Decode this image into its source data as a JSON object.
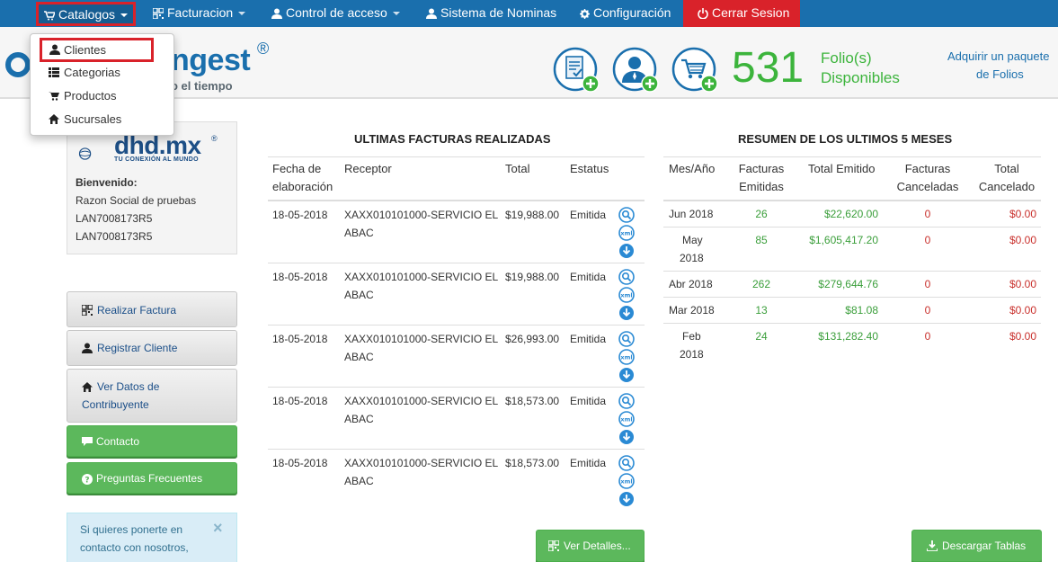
{
  "nav": {
    "catalogos": "Catalogos",
    "facturacion": "Facturacion",
    "control_acceso": "Control de acceso",
    "nominas": "Sistema de Nominas",
    "configuracion": "Configuración",
    "cerrar": "Cerrar Sesion"
  },
  "dropdown": {
    "items": [
      {
        "label": "Clientes",
        "icon": "user-icon"
      },
      {
        "label": "Categorias",
        "icon": "list-icon"
      },
      {
        "label": "Productos",
        "icon": "cart-icon"
      },
      {
        "label": "Sucursales",
        "icon": "home-icon"
      }
    ]
  },
  "header": {
    "brand_name": "ngest",
    "brand_reg": "®",
    "tagline": "o el tiempo",
    "folio_count": "531",
    "folio_label1": "Folio(s)",
    "folio_label2": "Disponibles",
    "buy_link1": "Adquirir un paquete",
    "buy_link2": "de Folios"
  },
  "profile": {
    "logo_text": "dhd.mx",
    "logo_reg": "®",
    "logo_tagline": "TU CONEXIÓN AL MUNDO",
    "welcome": "Bienvenido:",
    "razon": "Razon Social de pruebas",
    "rfc1": "LAN7008173R5",
    "rfc2": "LAN7008173R5"
  },
  "sidebar": {
    "factura": "Realizar Factura",
    "cliente": "Registrar Cliente",
    "datos1": "Ver Datos de",
    "datos2": "Contribuyente",
    "contacto": "Contacto",
    "preguntas": "Preguntas Frecuentes",
    "info_line1": "Si quieres ponerte en",
    "info_line2": "contacto con nosotros,",
    "info_close": "×"
  },
  "facturas": {
    "title": "ULTIMAS FACTURAS REALIZADAS",
    "headers": {
      "fecha1": "Fecha de",
      "fecha2": "elaboración",
      "receptor": "Receptor",
      "total": "Total",
      "estatus": "Estatus"
    },
    "rows": [
      {
        "fecha": "18-05-2018",
        "receptor1": "XAXX010101000-SERVICIO EL",
        "receptor2": "ABAC",
        "total": "$19,988.00",
        "estatus": "Emitida"
      },
      {
        "fecha": "18-05-2018",
        "receptor1": "XAXX010101000-SERVICIO EL",
        "receptor2": "ABAC",
        "total": "$19,988.00",
        "estatus": "Emitida"
      },
      {
        "fecha": "18-05-2018",
        "receptor1": "XAXX010101000-SERVICIO EL",
        "receptor2": "ABAC",
        "total": "$26,993.00",
        "estatus": "Emitida"
      },
      {
        "fecha": "18-05-2018",
        "receptor1": "XAXX010101000-SERVICIO EL",
        "receptor2": "ABAC",
        "total": "$18,573.00",
        "estatus": "Emitida"
      },
      {
        "fecha": "18-05-2018",
        "receptor1": "XAXX010101000-SERVICIO EL",
        "receptor2": "ABAC",
        "total": "$18,573.00",
        "estatus": "Emitida"
      }
    ],
    "xml_label": "xml",
    "details_button": "Ver Detalles..."
  },
  "resumen": {
    "title": "RESUMEN DE LOS ULTIMOS 5 MESES",
    "headers": {
      "mes": "Mes/Año",
      "emitidas1": "Facturas",
      "emitidas2": "Emitidas",
      "total_emitido": "Total Emitido",
      "canceladas1": "Facturas",
      "canceladas2": "Canceladas",
      "total_cancelado1": "Total",
      "total_cancelado2": "Cancelado"
    },
    "rows": [
      {
        "mes1": "Jun 2018",
        "mes2": "",
        "emitidas": "26",
        "total_emitido": "$22,620.00",
        "canceladas": "0",
        "total_cancelado": "$0.00"
      },
      {
        "mes1": "May",
        "mes2": "2018",
        "emitidas": "85",
        "total_emitido": "$1,605,417.20",
        "canceladas": "0",
        "total_cancelado": "$0.00"
      },
      {
        "mes1": "Abr 2018",
        "mes2": "",
        "emitidas": "262",
        "total_emitido": "$279,644.76",
        "canceladas": "0",
        "total_cancelado": "$0.00"
      },
      {
        "mes1": "Mar 2018",
        "mes2": "",
        "emitidas": "13",
        "total_emitido": "$81.08",
        "canceladas": "0",
        "total_cancelado": "$0.00"
      },
      {
        "mes1": "Feb",
        "mes2": "2018",
        "emitidas": "24",
        "total_emitido": "$131,282.40",
        "canceladas": "0",
        "total_cancelado": "$0.00"
      }
    ],
    "download_button": "Descargar Tablas"
  },
  "colors": {
    "navbar": "#1a6fad",
    "danger": "#d9222a",
    "success": "#5cb85c",
    "folio_green": "#3cb43c"
  }
}
